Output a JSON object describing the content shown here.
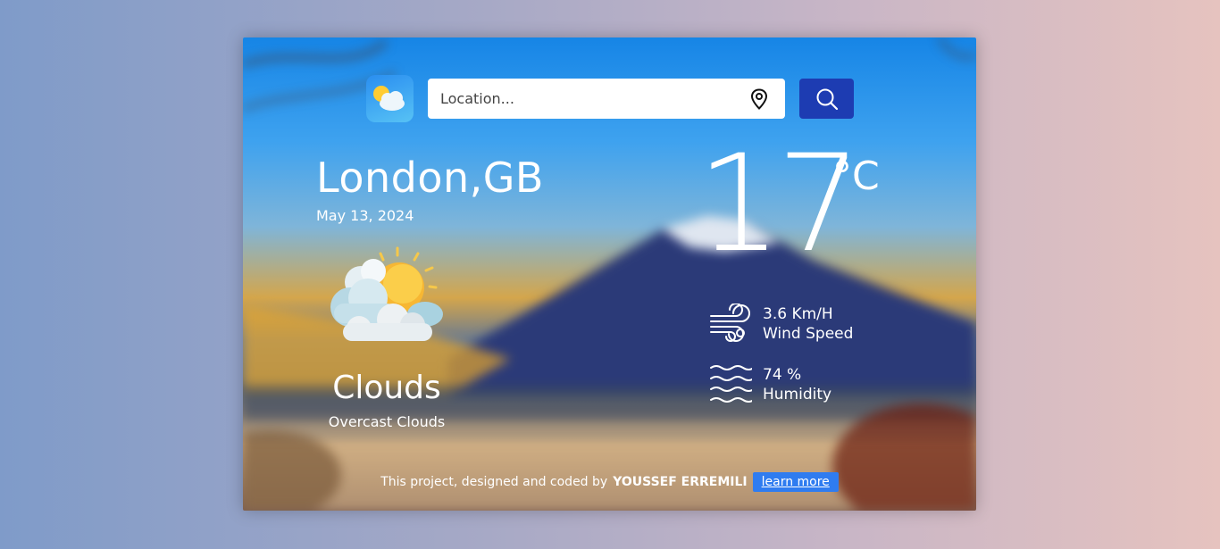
{
  "search": {
    "placeholder": "Location..."
  },
  "location": {
    "city": "London,",
    "country": "GB",
    "date": "May 13, 2024"
  },
  "weather": {
    "condition": "Clouds",
    "description": "Overcast Clouds",
    "temperature": "17",
    "unit": "°C",
    "icon": "partly-cloudy-sun-icon"
  },
  "stats": {
    "wind": {
      "value": "3.6 Km/H",
      "label": "Wind Speed",
      "icon": "wind-icon"
    },
    "humidity": {
      "value": "74 %",
      "label": "Humidity",
      "icon": "humidity-waves-icon"
    }
  },
  "footer": {
    "text": "This project, designed and coded by",
    "author": "YOUSSEF ERREMILI",
    "link_label": "learn more"
  },
  "colors": {
    "search_button": "#1d3cb2",
    "learn_more_button": "#2f7cf0"
  }
}
